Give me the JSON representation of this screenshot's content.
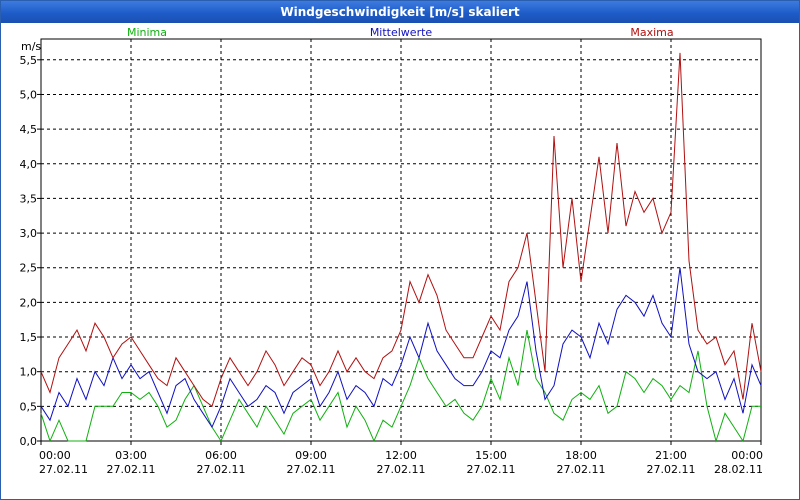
{
  "window": {
    "title": "Windgeschwindigkeit [m/s] skaliert"
  },
  "chart_data": {
    "type": "line",
    "ylabel": "m/s",
    "ylim": [
      0,
      5.8
    ],
    "yticks": [
      0,
      0.5,
      1,
      1.5,
      2,
      2.5,
      3,
      3.5,
      4,
      4.5,
      5,
      5.5
    ],
    "ytick_labels": [
      "0,0",
      "0,5",
      "1,0",
      "1,5",
      "2,0",
      "2,5",
      "3,0",
      "3,5",
      "4,0",
      "4,5",
      "5,0",
      "5,5"
    ],
    "xlim": [
      0,
      24
    ],
    "xticks": [
      0,
      3,
      6,
      9,
      12,
      15,
      18,
      21,
      24
    ],
    "xtick_labels": [
      {
        "time": "00:00",
        "date": "27.02.11"
      },
      {
        "time": "03:00",
        "date": "27.02.11"
      },
      {
        "time": "06:00",
        "date": "27.02.11"
      },
      {
        "time": "09:00",
        "date": "27.02.11"
      },
      {
        "time": "12:00",
        "date": "27.02.11"
      },
      {
        "time": "15:00",
        "date": "27.02.11"
      },
      {
        "time": "18:00",
        "date": "27.02.11"
      },
      {
        "time": "21:00",
        "date": "27.02.11"
      },
      {
        "time": "00:00",
        "date": "28.02.11"
      }
    ],
    "grid": true,
    "legend_position": "top",
    "series": [
      {
        "name": "Minima",
        "color": "#10b010",
        "x": [
          0,
          0.3,
          0.6,
          0.9,
          1.2,
          1.5,
          1.8,
          2.1,
          2.4,
          2.7,
          3.0,
          3.3,
          3.6,
          3.9,
          4.2,
          4.5,
          4.8,
          5.1,
          5.4,
          5.7,
          6.0,
          6.3,
          6.6,
          6.9,
          7.2,
          7.5,
          7.8,
          8.1,
          8.4,
          8.7,
          9.0,
          9.3,
          9.6,
          9.9,
          10.2,
          10.5,
          10.8,
          11.1,
          11.4,
          11.7,
          12.0,
          12.3,
          12.6,
          12.9,
          13.2,
          13.5,
          13.8,
          14.1,
          14.4,
          14.7,
          15.0,
          15.3,
          15.6,
          15.9,
          16.2,
          16.5,
          16.8,
          17.1,
          17.4,
          17.7,
          18.0,
          18.3,
          18.6,
          18.9,
          19.2,
          19.5,
          19.8,
          20.1,
          20.4,
          20.7,
          21.0,
          21.3,
          21.6,
          21.9,
          22.2,
          22.5,
          22.8,
          23.1,
          23.4,
          23.7,
          24.0
        ],
        "values": [
          0.4,
          0,
          0.3,
          0,
          0,
          0,
          0.5,
          0.5,
          0.5,
          0.7,
          0.7,
          0.6,
          0.7,
          0.5,
          0.2,
          0.3,
          0.6,
          0.8,
          0.5,
          0.2,
          0,
          0.3,
          0.6,
          0.4,
          0.2,
          0.5,
          0.3,
          0.1,
          0.4,
          0.5,
          0.6,
          0.3,
          0.5,
          0.7,
          0.2,
          0.5,
          0.3,
          0,
          0.3,
          0.2,
          0.5,
          0.8,
          1.2,
          0.9,
          0.7,
          0.5,
          0.6,
          0.4,
          0.3,
          0.5,
          0.9,
          0.6,
          1.2,
          0.8,
          1.6,
          0.9,
          0.7,
          0.4,
          0.3,
          0.6,
          0.7,
          0.6,
          0.8,
          0.4,
          0.5,
          1.0,
          0.9,
          0.7,
          0.9,
          0.8,
          0.6,
          0.8,
          0.7,
          1.3,
          0.5,
          0,
          0.4,
          0.2,
          0,
          0.5,
          0.5
        ]
      },
      {
        "name": "Mittelwerte",
        "color": "#1010c0",
        "x": [
          0,
          0.3,
          0.6,
          0.9,
          1.2,
          1.5,
          1.8,
          2.1,
          2.4,
          2.7,
          3.0,
          3.3,
          3.6,
          3.9,
          4.2,
          4.5,
          4.8,
          5.1,
          5.4,
          5.7,
          6.0,
          6.3,
          6.6,
          6.9,
          7.2,
          7.5,
          7.8,
          8.1,
          8.4,
          8.7,
          9.0,
          9.3,
          9.6,
          9.9,
          10.2,
          10.5,
          10.8,
          11.1,
          11.4,
          11.7,
          12.0,
          12.3,
          12.6,
          12.9,
          13.2,
          13.5,
          13.8,
          14.1,
          14.4,
          14.7,
          15.0,
          15.3,
          15.6,
          15.9,
          16.2,
          16.5,
          16.8,
          17.1,
          17.4,
          17.7,
          18.0,
          18.3,
          18.6,
          18.9,
          19.2,
          19.5,
          19.8,
          20.1,
          20.4,
          20.7,
          21.0,
          21.3,
          21.6,
          21.9,
          22.2,
          22.5,
          22.8,
          23.1,
          23.4,
          23.7,
          24.0
        ],
        "values": [
          0.5,
          0.3,
          0.7,
          0.5,
          0.9,
          0.6,
          1.0,
          0.8,
          1.2,
          0.9,
          1.1,
          0.9,
          1.0,
          0.7,
          0.4,
          0.8,
          0.9,
          0.6,
          0.4,
          0.2,
          0.5,
          0.9,
          0.7,
          0.5,
          0.6,
          0.8,
          0.7,
          0.4,
          0.7,
          0.8,
          0.9,
          0.5,
          0.7,
          1.0,
          0.6,
          0.8,
          0.7,
          0.5,
          0.9,
          0.8,
          1.1,
          1.5,
          1.2,
          1.7,
          1.3,
          1.1,
          0.9,
          0.8,
          0.8,
          1.0,
          1.3,
          1.2,
          1.6,
          1.8,
          2.3,
          1.3,
          0.6,
          0.8,
          1.4,
          1.6,
          1.5,
          1.2,
          1.7,
          1.4,
          1.9,
          2.1,
          2.0,
          1.8,
          2.1,
          1.7,
          1.5,
          2.5,
          1.4,
          1.0,
          0.9,
          1.0,
          0.6,
          0.9,
          0.4,
          1.1,
          0.8
        ]
      },
      {
        "name": "Maxima",
        "color": "#b01010",
        "x": [
          0,
          0.3,
          0.6,
          0.9,
          1.2,
          1.5,
          1.8,
          2.1,
          2.4,
          2.7,
          3.0,
          3.3,
          3.6,
          3.9,
          4.2,
          4.5,
          4.8,
          5.1,
          5.4,
          5.7,
          6.0,
          6.3,
          6.6,
          6.9,
          7.2,
          7.5,
          7.8,
          8.1,
          8.4,
          8.7,
          9.0,
          9.3,
          9.6,
          9.9,
          10.2,
          10.5,
          10.8,
          11.1,
          11.4,
          11.7,
          12.0,
          12.3,
          12.6,
          12.9,
          13.2,
          13.5,
          13.8,
          14.1,
          14.4,
          14.7,
          15.0,
          15.3,
          15.6,
          15.9,
          16.2,
          16.5,
          16.8,
          17.1,
          17.4,
          17.7,
          18.0,
          18.3,
          18.6,
          18.9,
          19.2,
          19.5,
          19.8,
          20.1,
          20.4,
          20.7,
          21.0,
          21.3,
          21.6,
          21.9,
          22.2,
          22.5,
          22.8,
          23.1,
          23.4,
          23.7,
          24.0
        ],
        "values": [
          1.0,
          0.7,
          1.2,
          1.4,
          1.6,
          1.3,
          1.7,
          1.5,
          1.2,
          1.4,
          1.5,
          1.3,
          1.1,
          0.9,
          0.8,
          1.2,
          1.0,
          0.8,
          0.6,
          0.5,
          0.9,
          1.2,
          1.0,
          0.8,
          1.0,
          1.3,
          1.1,
          0.8,
          1.0,
          1.2,
          1.1,
          0.8,
          1.0,
          1.3,
          1.0,
          1.2,
          1.0,
          0.9,
          1.2,
          1.3,
          1.6,
          2.3,
          2.0,
          2.4,
          2.1,
          1.6,
          1.4,
          1.2,
          1.2,
          1.5,
          1.8,
          1.6,
          2.3,
          2.5,
          3.0,
          2.0,
          1.0,
          4.4,
          2.5,
          3.5,
          2.3,
          3.2,
          4.1,
          3.0,
          4.3,
          3.1,
          3.6,
          3.3,
          3.5,
          3.0,
          3.3,
          5.6,
          2.6,
          1.6,
          1.4,
          1.5,
          1.1,
          1.3,
          0.6,
          1.7,
          1.0
        ]
      }
    ]
  }
}
